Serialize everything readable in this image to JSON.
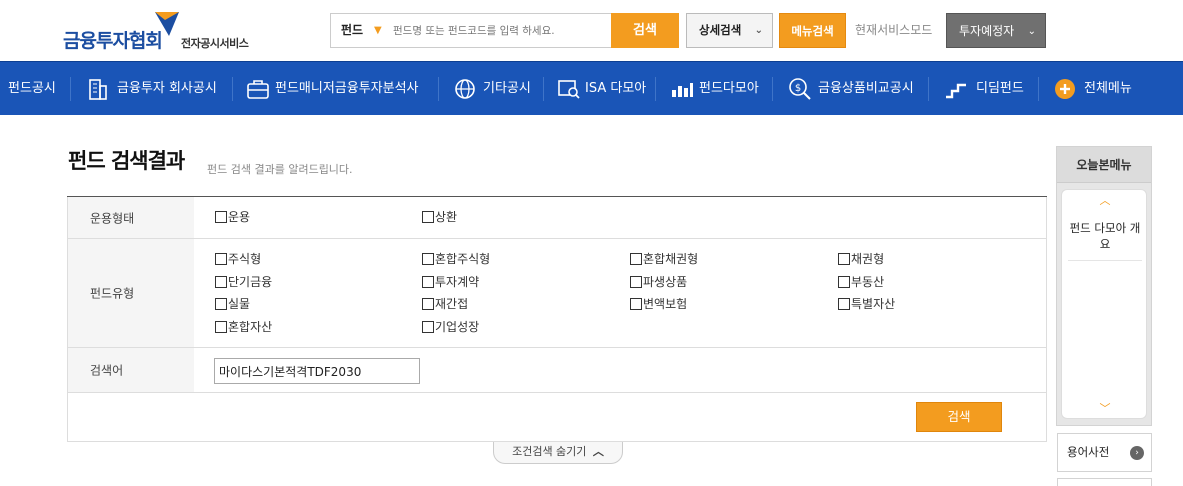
{
  "header": {
    "logo_main": "금융투자협회",
    "logo_sub": "전자공시서비스",
    "search_type": "펀드",
    "search_placeholder": "펀드명 또는 펀드코드를 입력 하세요.",
    "search_button": "검색",
    "advanced_search": "상세검색",
    "menu_search": "메뉴검색",
    "service_mode": "현재서비스모드",
    "investor_mode": "투자예정자"
  },
  "nav": {
    "items": [
      {
        "label": "펀드공시",
        "icon": "fund-disclosure-icon"
      },
      {
        "label": "금융투자 회사공시",
        "icon": "building-icon"
      },
      {
        "label": "펀드매니저금융투자분석사",
        "icon": "briefcase-icon"
      },
      {
        "label": "기타공시",
        "icon": "globe-icon"
      },
      {
        "label": "ISA 다모아",
        "icon": "isa-search-icon"
      },
      {
        "label": "펀드다모아",
        "icon": "bar-chart-icon"
      },
      {
        "label": "금융상품비교공시",
        "icon": "dollar-search-icon"
      },
      {
        "label": "디딤펀드",
        "icon": "steps-icon"
      },
      {
        "label": "전체메뉴",
        "icon": "plus-circle-icon"
      }
    ]
  },
  "page": {
    "title": "펀드 검색결과",
    "subtitle": "펀드 검색 결과를 알려드립니다."
  },
  "form": {
    "operation_label": "운용형태",
    "operation_options": [
      "운용",
      "상환"
    ],
    "fund_type_label": "펀드유형",
    "fund_type_options": [
      "주식형",
      "혼합주식형",
      "혼합채권형",
      "채권형",
      "단기금융",
      "투자계약",
      "파생상품",
      "부동산",
      "실물",
      "재간접",
      "변액보험",
      "특별자산",
      "혼합자산",
      "기업성장"
    ],
    "keyword_label": "검색어",
    "keyword_value": "마이다스기본적격TDF2030",
    "search_button": "검색",
    "toggle_label": "조건검색 숨기기"
  },
  "side": {
    "title": "오늘본메뉴",
    "items": [
      "펀드 다모아 개요"
    ],
    "dictionary": "용어사전"
  },
  "colors": {
    "brand_blue": "#1a55b7",
    "accent_orange": "#f39c1f"
  }
}
